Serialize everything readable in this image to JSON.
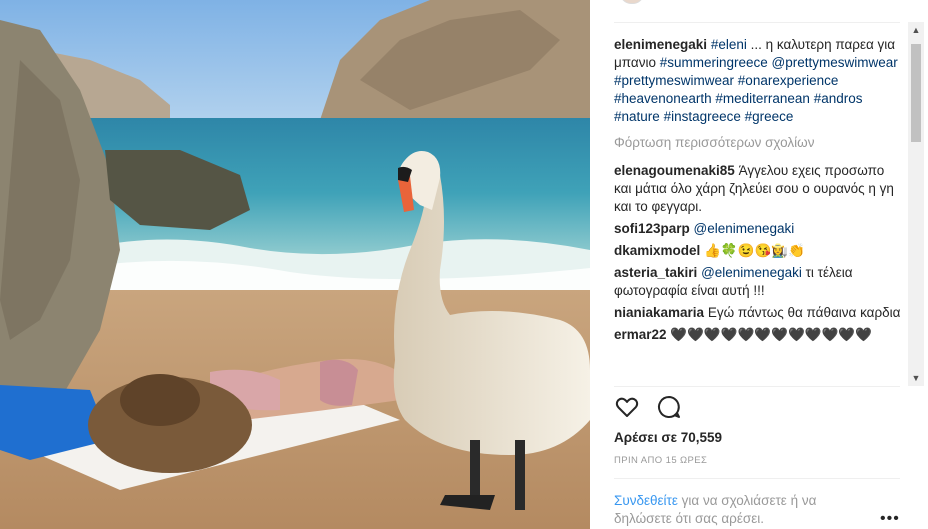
{
  "caption": {
    "username": "elenimenegaki",
    "parts": [
      {
        "t": "#eleni",
        "tag": true
      },
      {
        "t": " ... η καλυτερη παρεα για μπανιο ",
        "tag": false
      },
      {
        "t": "#summeringreece",
        "tag": true
      },
      {
        "t": " ",
        "tag": false
      },
      {
        "t": "@prettymeswimwear",
        "tag": true
      },
      {
        "t": " ",
        "tag": false
      },
      {
        "t": "#prettymeswimwear",
        "tag": true
      },
      {
        "t": " ",
        "tag": false
      },
      {
        "t": "#onarexperience",
        "tag": true
      },
      {
        "t": " ",
        "tag": false
      },
      {
        "t": "#heavenonearth",
        "tag": true
      },
      {
        "t": " ",
        "tag": false
      },
      {
        "t": "#mediterranean",
        "tag": true
      },
      {
        "t": " ",
        "tag": false
      },
      {
        "t": "#andros",
        "tag": true
      },
      {
        "t": " ",
        "tag": false
      },
      {
        "t": "#nature",
        "tag": true
      },
      {
        "t": " ",
        "tag": false
      },
      {
        "t": "#instagreece",
        "tag": true
      },
      {
        "t": " ",
        "tag": false
      },
      {
        "t": "#greece",
        "tag": true
      }
    ]
  },
  "load_more": "Φόρτωση περισσότερων σχολίων",
  "comments": [
    {
      "user": "elenagoumenaki85",
      "parts": [
        {
          "t": "Άγγελου εχεις προσωπο και μάτια όλο χάρη ζηλεύει σου ο ουρανός η γη και το φεγγαρι.",
          "tag": false
        }
      ]
    },
    {
      "user": "sofi123parp",
      "parts": [
        {
          "t": "@elenimenegaki",
          "tag": true
        }
      ]
    },
    {
      "user": "dkamixmodel",
      "parts": [
        {
          "t": "👍🍀😉😘👩‍🌾👏",
          "tag": false
        }
      ]
    },
    {
      "user": "asteria_takiri",
      "parts": [
        {
          "t": "@elenimenegaki",
          "tag": true
        },
        {
          "t": " τι τέλεια φωτογραφία είναι αυτή !!!",
          "tag": false
        }
      ]
    },
    {
      "user": "nianiakamaria",
      "parts": [
        {
          "t": "Εγώ πάντως θα πάθαινα καρδια",
          "tag": false
        }
      ]
    },
    {
      "user": "ermar22",
      "parts": [
        {
          "t": "🖤🖤🖤🖤🖤🖤🖤🖤🖤🖤🖤🖤",
          "tag": false
        }
      ]
    }
  ],
  "likes": "Αρέσει σε 70,559",
  "time": "ΠΡΙΝ ΑΠΟ 15 ΩΡΕΣ",
  "login": {
    "link": "Συνδεθείτε",
    "rest": " για να σχολιάσετε ή να δηλώσετε ότι σας αρέσει."
  },
  "more": "•••",
  "icons": {
    "like": "heart-icon",
    "comment": "speech-bubble-icon",
    "scroll_up": "▲",
    "scroll_down": "▼"
  },
  "colors": {
    "link": "#003569",
    "login_link": "#3897f0",
    "muted": "#999999"
  }
}
